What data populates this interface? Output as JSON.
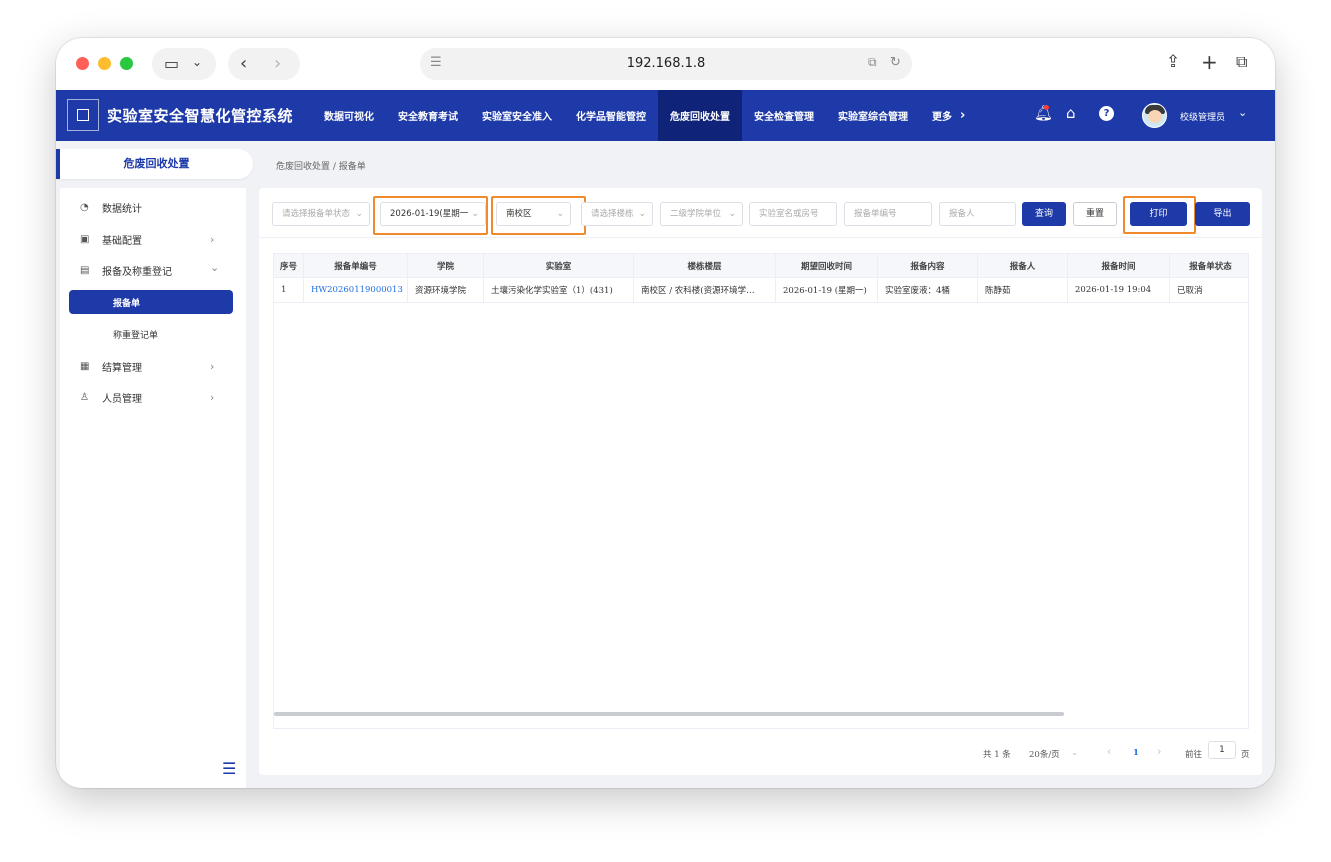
{
  "browser": {
    "address": "192.168.1.8"
  },
  "header": {
    "title": "实验室安全智慧化管控系统",
    "nav": [
      {
        "label": "数据可视化",
        "active": false
      },
      {
        "label": "安全教育考试",
        "active": false
      },
      {
        "label": "实验室安全准入",
        "active": false
      },
      {
        "label": "化学品智能管控",
        "active": false
      },
      {
        "label": "危废回收处置",
        "active": true
      },
      {
        "label": "安全检查管理",
        "active": false
      },
      {
        "label": "实验室综合管理",
        "active": false
      },
      {
        "label": "更多",
        "active": false
      }
    ],
    "user": "校级管理员"
  },
  "sidebar": {
    "section_title": "危废回收处置",
    "items": [
      {
        "label": "数据统计",
        "icon": "pie-chart-icon",
        "caret": ""
      },
      {
        "label": "基础配置",
        "icon": "monitor-icon",
        "caret": "›"
      },
      {
        "label": "报备及称重登记",
        "icon": "document-icon",
        "caret": "⌄"
      },
      {
        "label": "结算管理",
        "icon": "calculator-icon",
        "caret": "›"
      },
      {
        "label": "人员管理",
        "icon": "person-icon",
        "caret": "›"
      }
    ],
    "subitems": [
      {
        "label": "报备单",
        "active": true
      },
      {
        "label": "称重登记单",
        "active": false
      }
    ]
  },
  "breadcrumb": "危废回收处置 / 报备单",
  "filters": {
    "status_placeholder": "请选择报备单状态",
    "date_value": "2026-01-19(星期一",
    "campus_value": "南校区",
    "building_placeholder": "请选择楼栋",
    "unit_placeholder": "二级学院单位",
    "lab_placeholder": "实验室名或房号",
    "report_no_placeholder": "报备单编号",
    "reporter_placeholder": "报备人",
    "query_label": "查询",
    "reset_label": "重置",
    "print_label": "打印",
    "export_label": "导出"
  },
  "table": {
    "columns": [
      "序号",
      "报备单编号",
      "学院",
      "实验室",
      "楼栋楼层",
      "期望回收时间",
      "报备内容",
      "报备人",
      "报备时间",
      "报备单状态"
    ],
    "rows": [
      [
        "1",
        "HW20260119000013",
        "资源环境学院",
        "土壤污染化学实验室（1）(431)",
        "南校区 / 农科楼(资源环境学…",
        "2026-01-19 (星期一)",
        "实验室废液：4桶",
        "陈静茹",
        "2026-01-19 19:04",
        "已取消"
      ]
    ]
  },
  "pagination": {
    "total": "共 1 条",
    "page_size": "20条/页",
    "current_page": "1",
    "goto_label": "前往",
    "goto_value": "1",
    "page_suffix": "页"
  },
  "colors": {
    "primary": "#1e3aa8",
    "highlight": "#f0892b",
    "link": "#1e6fe0"
  }
}
